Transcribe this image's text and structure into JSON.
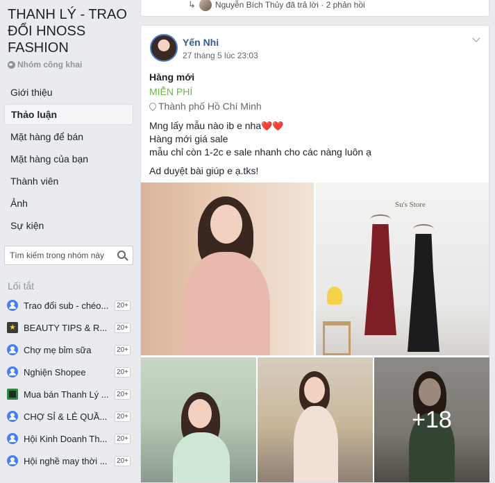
{
  "sidebar": {
    "group_title": "THANH LÝ - TRAO ĐỔI HNOSS FASHION",
    "privacy": "Nhóm công khai",
    "nav": [
      {
        "label": "Giới thiệu"
      },
      {
        "label": "Thảo luận",
        "active": true
      },
      {
        "label": "Mặt hàng để bán"
      },
      {
        "label": "Mặt hàng của bạn"
      },
      {
        "label": "Thành viên"
      },
      {
        "label": "Ảnh"
      },
      {
        "label": "Sự kiện"
      }
    ],
    "search": {
      "placeholder": "Tìm kiếm trong nhóm này"
    },
    "shortcuts_title": "Lối tắt",
    "shortcuts": [
      {
        "label": "Trao đổi sub - chéo...",
        "badge": "20+",
        "icon": "group-icon"
      },
      {
        "label": "BEAUTY TIPS & R...",
        "badge": "20+",
        "icon": "star-icon"
      },
      {
        "label": "Chợ mẹ bỉm sữa",
        "badge": "20+",
        "icon": "group-icon"
      },
      {
        "label": "Nghiện Shopee",
        "badge": "20+",
        "icon": "group-icon"
      },
      {
        "label": "Mua bán Thanh Lý ...",
        "badge": "20+",
        "icon": "square-icon"
      },
      {
        "label": "CHỢ SỈ & LẺ QUẦ...",
        "badge": "20+",
        "icon": "group-icon"
      },
      {
        "label": "Hội Kinh Doanh Th...",
        "badge": "20+",
        "icon": "group-icon"
      },
      {
        "label": "Hội nghề may thời ...",
        "badge": "20+",
        "icon": "group-icon"
      }
    ]
  },
  "prev_post": {
    "reply_text": "Nguyễn Bích Thủy đã trả lời · 2 phản hồi"
  },
  "post": {
    "author": "Yến Nhi",
    "timestamp": "27 tháng 5 lúc 23:03",
    "item_title": "Hàng mới",
    "price": "MIỄN PHÍ",
    "location": "Thành phố Hồ Chí Minh",
    "body_line1": "Mng lấy mẫu nào ib e nha",
    "hearts": "❤️❤️",
    "body_line2": "Hàng mới giá sale",
    "body_line3": "mẫu chỉ còn 1-2c e sale nhanh cho các nàng luôn ạ",
    "body_line4": "Ad duyệt bài giúp e ạ.tks!",
    "store_watermark": "Su's Store",
    "more_photos": "+18"
  },
  "colors": {
    "link": "#365899",
    "price_green": "#6bb44a",
    "background": "#e9ebee"
  }
}
